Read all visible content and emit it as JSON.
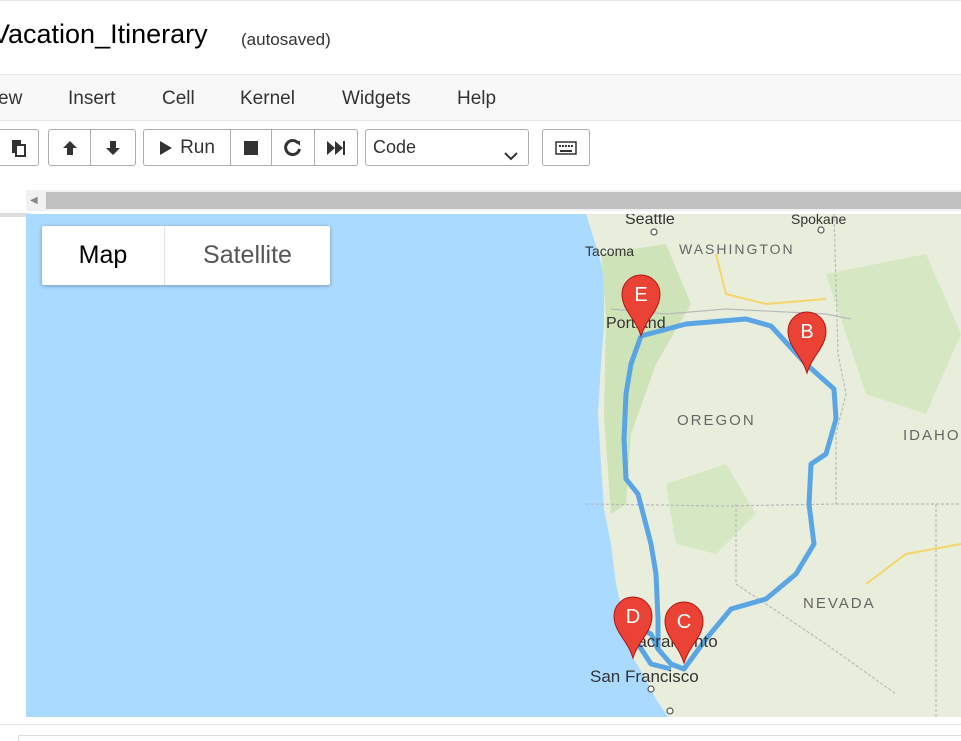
{
  "header": {
    "title": "Vacation_Itinerary",
    "autosave": "(autosaved)"
  },
  "menu": {
    "items": [
      "ew",
      "Insert",
      "Cell",
      "Kernel",
      "Widgets",
      "Help"
    ]
  },
  "toolbar": {
    "run_label": "Run",
    "cell_type": "Code"
  },
  "map": {
    "map_type_active": "Map",
    "map_type_inactive": "Satellite",
    "labels": {
      "seattle": "Seattle",
      "spokane": "Spokane",
      "tacoma": "Tacoma",
      "washington": "WASHINGTON",
      "portland": "Portland",
      "oregon": "OREGON",
      "idaho": "IDAHO",
      "nevada": "NEVADA",
      "sacramento": "Sacramento",
      "san_francisco": "San Francisco"
    },
    "markers": [
      "B",
      "C",
      "D",
      "E"
    ],
    "route_color": "#4a9de6",
    "marker_color": "#ea4335",
    "water_color": "#aadaff",
    "land_color": "#e8eedb"
  }
}
